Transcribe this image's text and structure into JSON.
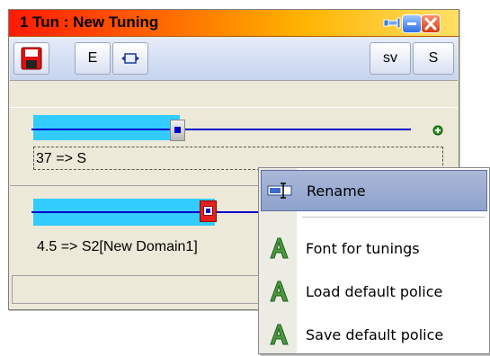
{
  "window": {
    "title": "1  Tun : New Tuning"
  },
  "toolbar": {
    "save_icon": "floppy-disk-icon",
    "e_label": "E",
    "resize_icon": "horizontal-resize-icon",
    "sv_label": "sv",
    "s_label": "S"
  },
  "tunings": [
    {
      "value_text": "37 => S",
      "slider_level": 0.38,
      "add_icon": "plus-icon"
    },
    {
      "value_text": "4.5 => S2[New Domain1]",
      "slider_level": 0.48
    }
  ],
  "context_menu": {
    "items": [
      {
        "label": "Rename",
        "icon": "rename-icon",
        "selected": true
      },
      {
        "label": "Font for tunings",
        "icon": "font-a-icon"
      },
      {
        "label": "Load default police",
        "icon": "font-a-icon"
      },
      {
        "label": "Save default police",
        "icon": "font-a-icon"
      }
    ]
  },
  "colors": {
    "title_gradient_start": "#ff1a00",
    "title_gradient_end": "#ffe066",
    "slider_fill": "#33ccff",
    "slider_line": "#0000cc",
    "menu_highlight": "#9aabd2"
  }
}
